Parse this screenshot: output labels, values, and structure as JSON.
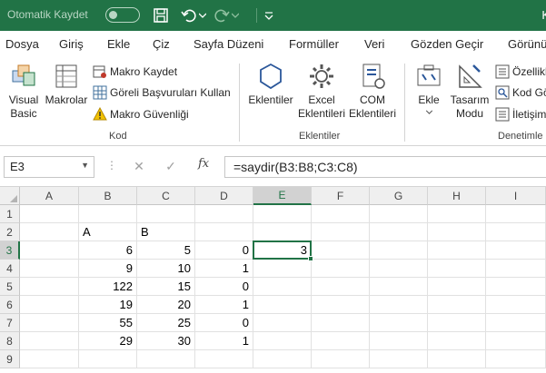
{
  "titlebar": {
    "autosave_label": "Otomatik Kaydet",
    "autosave_state": "off",
    "right_fragment": "K",
    "icons": [
      "save-icon",
      "undo-icon",
      "redo-icon",
      "customize-qat-icon"
    ],
    "bg_color": "#217346"
  },
  "tabs": [
    "Dosya",
    "Giriş",
    "Ekle",
    "Çiz",
    "Sayfa Düzeni",
    "Formüller",
    "Veri",
    "Gözden Geçir",
    "Görünü"
  ],
  "ribbon": {
    "kod": {
      "group_label": "Kod",
      "visual_basic": "Visual\nBasic",
      "makrolar": "Makrolar",
      "makro_kaydet": "Makro Kaydet",
      "goreli": "Göreli Başvuruları Kullan",
      "makro_guvenligi": "Makro Güvenliği"
    },
    "eklentiler": {
      "group_label": "Eklentiler",
      "eklentiler_btn": "Eklentiler",
      "excel_eklentileri": "Excel\nEklentileri",
      "com_eklentileri": "COM\nEklentileri"
    },
    "denetimler": {
      "group_label": "Denetimle",
      "ekle": "Ekle",
      "tasarim_modu": "Tasarım\nModu",
      "ozellikler": "Özellikl",
      "kod_goster": "Kod Gö",
      "iletisim": "İletişim"
    }
  },
  "formula_bar": {
    "name_box": "E3",
    "formula": "=saydir(B3:B8;C3:C8)",
    "fx": "fx"
  },
  "sheet": {
    "columns": [
      "A",
      "B",
      "C",
      "D",
      "E",
      "F",
      "G",
      "H",
      "I"
    ],
    "rows": [
      "1",
      "2",
      "3",
      "4",
      "5",
      "6",
      "7",
      "8",
      "9"
    ],
    "selected_column": "E",
    "selected_row": "3",
    "active_cell": "E3",
    "cells": {
      "B2": "A",
      "C2": "B",
      "B3": "6",
      "C3": "5",
      "D3": "0",
      "E3": "3",
      "B4": "9",
      "C4": "10",
      "D4": "1",
      "B5": "122",
      "C5": "15",
      "D5": "0",
      "B6": "19",
      "C6": "20",
      "D6": "1",
      "B7": "55",
      "C7": "25",
      "D7": "0",
      "B8": "29",
      "C8": "30",
      "D8": "1"
    }
  }
}
